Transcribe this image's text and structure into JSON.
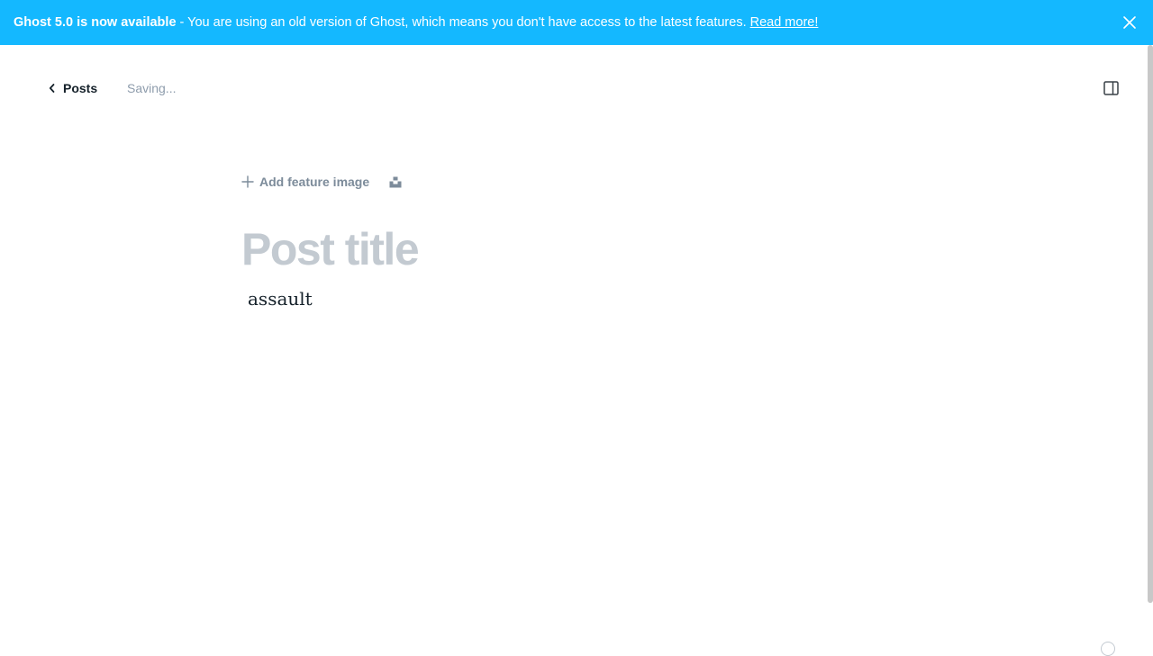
{
  "banner": {
    "strong_text": "Ghost 5.0 is now available",
    "message": " - You are using an old version of Ghost, which means you don't have access to the latest features.",
    "link_label": "Read more!",
    "background_color": "#14b8ff",
    "close_icon": "close-icon"
  },
  "header": {
    "back_label": "Posts",
    "back_icon": "chevron-left-icon",
    "status_text": "Saving...",
    "sidebar_toggle_icon": "sidebar-panel-icon"
  },
  "editor": {
    "feature_image_label": "Add feature image",
    "feature_image_icon": "plus-icon",
    "unsplash_icon": "unsplash-icon",
    "title_placeholder": "Post title",
    "body_text": "assault"
  },
  "colors": {
    "text_primary": "#15212a",
    "text_muted": "#8e9cac",
    "title_placeholder": "#c3cad1"
  }
}
